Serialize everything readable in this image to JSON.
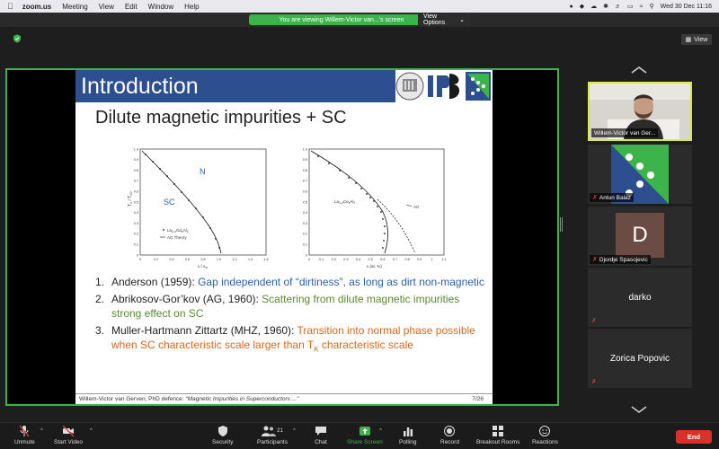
{
  "menubar": {
    "app": "zoom.us",
    "items": [
      "Meeting",
      "View",
      "Edit",
      "Window",
      "Help"
    ],
    "datetime": "Wed 30 Dec  11:16"
  },
  "share_banner": {
    "text": "You are viewing Willem-Victor van...'s screen",
    "view_options": "View Options"
  },
  "view_button": "View",
  "slide": {
    "title": "Introduction",
    "subtitle": "Dilute magnetic impurities + SC",
    "plot1": {
      "ylabel": "T_c / T_c0",
      "xlabel": "x / x_cr",
      "region_n": "N",
      "region_sc": "SC",
      "legend_points": "La_{1-x}Gd_xAl_2",
      "legend_line": "AG Theory",
      "xticks": [
        "0",
        "0.2",
        "0.4",
        "0.6",
        "0.8",
        "1.0",
        "1.2",
        "1.4",
        "1.6"
      ],
      "yticks": [
        "0",
        "0.1",
        "0.2",
        "0.3",
        "0.4",
        "0.5",
        "0.6",
        "0.7",
        "0.8",
        "0.9",
        "1.0"
      ]
    },
    "plot2": {
      "xlabel": "x (at. %)",
      "label_series": "La_{1-x}Ce_xAl_2",
      "label_ag": "AG",
      "xticks": [
        "0",
        "0.1",
        "0.2",
        "0.3",
        "0.4",
        "0.5",
        "0.6",
        "0.7",
        "0.8",
        "0.9",
        "1",
        "1.1"
      ],
      "yticks": [
        "0",
        "0.1",
        "0.2",
        "0.3",
        "0.4",
        "0.5",
        "0.6",
        "0.7",
        "0.8",
        "0.9",
        "1.0"
      ]
    },
    "items": [
      {
        "num": "1.",
        "lead": "Anderson (1959): ",
        "desc": "Gap independent of “dirtiness”, as long as dirt non-magnetic"
      },
      {
        "num": "2.",
        "lead": "Abrikosov-Gor’kov (AG, 1960): ",
        "desc": "Scattering from dilute magnetic impurities strong effect on SC"
      },
      {
        "num": "3.",
        "lead": "Muller-Hartmann Zittartz (MHZ, 1960): ",
        "desc": "Transition into normal phase possible when SC characteristic scale larger than T",
        "desc_sub": "K",
        "desc_tail": " characteristic scale"
      }
    ],
    "footer_author": "Willem-Victor van Gerven, PhD defence: ",
    "footer_title": "“Magnetic Impurities in Superconductors ...”",
    "page": "7/26"
  },
  "participants": [
    {
      "name": "Willem-Victor van Ger...",
      "type": "video"
    },
    {
      "name": "Antun Balaz",
      "type": "logo"
    },
    {
      "name": "Djordje Spasojevic",
      "type": "avatar",
      "initial": "D"
    },
    {
      "name": "darko",
      "type": "name-only"
    },
    {
      "name": "Zorica Popovic",
      "type": "name-only"
    }
  ],
  "toolbar": {
    "unmute": "Unmute",
    "start_video": "Start Video",
    "security": "Security",
    "participants": "Participants",
    "participants_count": "21",
    "chat": "Chat",
    "share_screen": "Share Screen",
    "polling": "Polling",
    "record": "Record",
    "breakout": "Breakout Rooms",
    "reactions": "Reactions",
    "end": "End"
  },
  "colors": {
    "accent_green": "#3cb44b",
    "slide_header": "#2e4f8f",
    "end_red": "#d9302a",
    "active_speaker": "#d6e84a"
  }
}
